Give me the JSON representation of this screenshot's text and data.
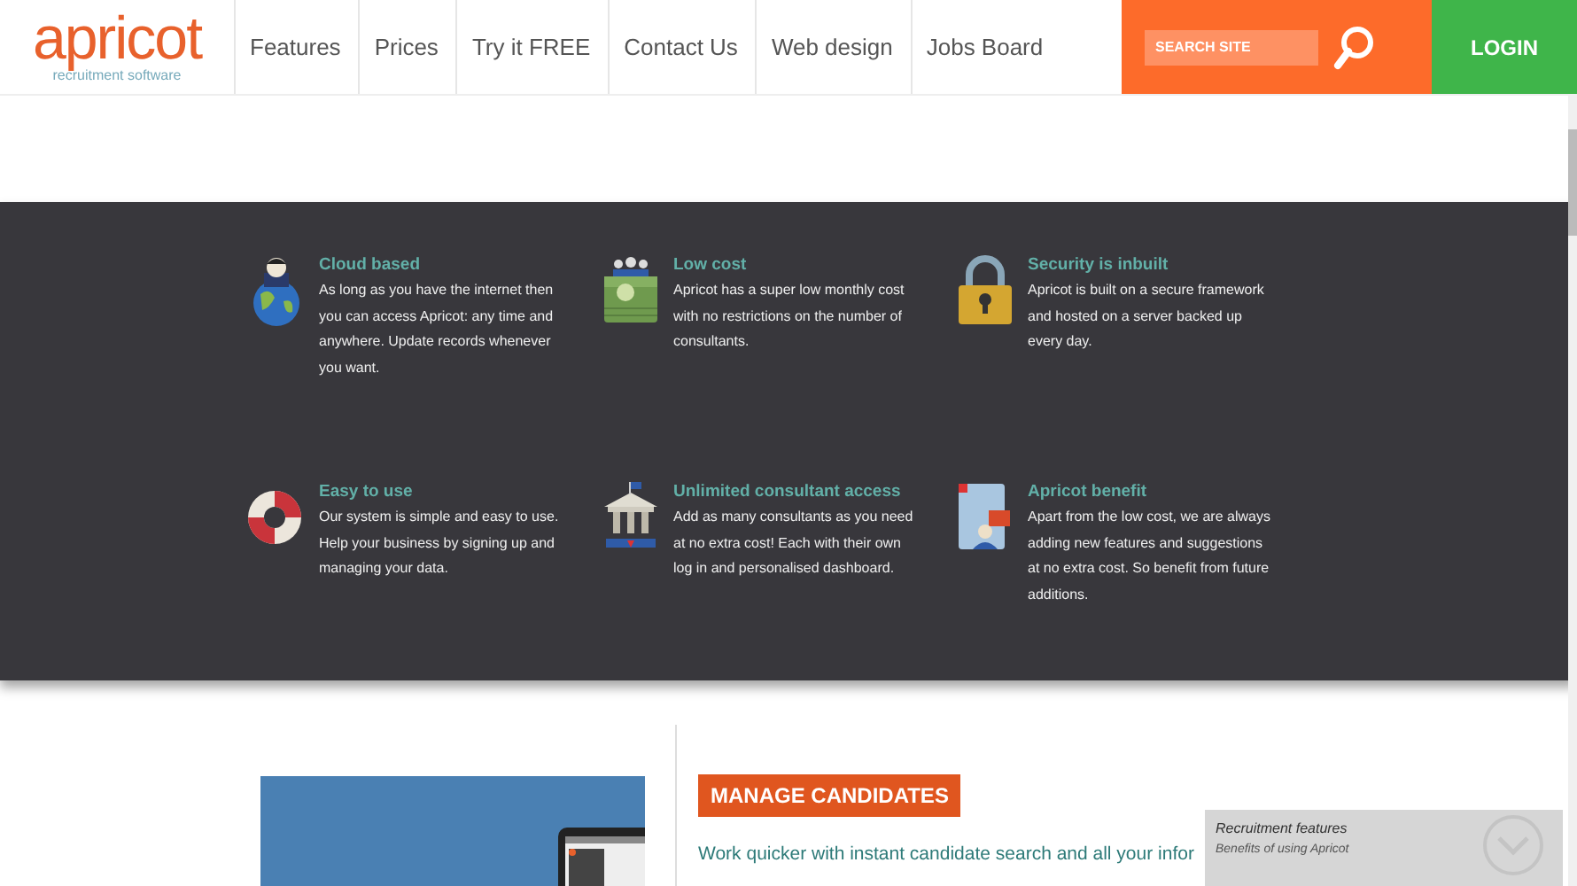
{
  "header": {
    "logo": {
      "name": "apricot",
      "tagline": "recruitment software"
    },
    "nav": [
      {
        "label": "Features"
      },
      {
        "label": "Prices"
      },
      {
        "label": "Try it FREE"
      },
      {
        "label": "Contact Us"
      },
      {
        "label": "Web design"
      },
      {
        "label": "Jobs Board"
      }
    ],
    "search": {
      "placeholder": "SEARCH SITE"
    },
    "login": "LOGIN"
  },
  "features": [
    {
      "kind": "person-globe",
      "title": "Cloud based",
      "text": "As long as you have the internet then you can access Apricot: any time and anywhere. Update records whenever you want."
    },
    {
      "kind": "money",
      "title": "Low cost",
      "text": "Apricot has a super low monthly cost with no restrictions on the number of consultants."
    },
    {
      "kind": "padlock",
      "title": "Security is inbuilt",
      "text": "Apricot is built on a secure framework and hosted on a server backed up every day."
    },
    {
      "kind": "lifebuoy",
      "title": "Easy to use",
      "text": "Our system is simple and easy to use. Help your business by signing up and managing your data."
    },
    {
      "kind": "building",
      "title": "Unlimited consultant access",
      "text": "Add as many consultants as you need at no extra cost! Each with their own log in and personalised dashboard."
    },
    {
      "kind": "book",
      "title": "Apricot benefit",
      "text": "Apart from the low cost, we are always adding new features and suggestions at no extra cost. So benefit from future additions."
    }
  ],
  "section": {
    "heading": "MANAGE CANDIDATES",
    "text": "Work quicker with instant candidate search and all your infor"
  },
  "popup": {
    "title": "Recruitment features",
    "subtitle": "Benefits of using Apricot"
  }
}
